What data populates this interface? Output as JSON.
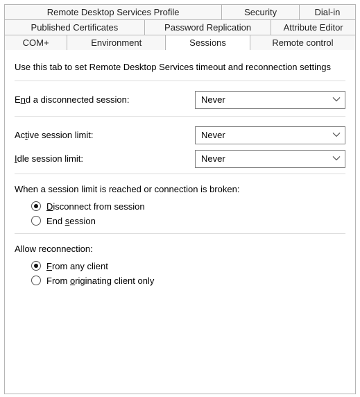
{
  "tabs": {
    "row1": [
      "Remote Desktop Services Profile",
      "Security",
      "Dial-in"
    ],
    "row2": [
      "Published Certificates",
      "Password Replication",
      "Attribute Editor"
    ],
    "row3": [
      "COM+",
      "Environment",
      "Sessions",
      "Remote control"
    ],
    "active": "Sessions"
  },
  "intro": "Use this tab to set Remote Desktop Services timeout and reconnection settings",
  "fields": {
    "end_disconnected": {
      "label_pre": "E",
      "label_u": "n",
      "label_post": "d a disconnected session:",
      "value": "Never"
    },
    "active_limit": {
      "label_pre": "Ac",
      "label_u": "t",
      "label_post": "ive session limit:",
      "value": "Never"
    },
    "idle_limit": {
      "label_pre": "",
      "label_u": "I",
      "label_post": "dle session limit:",
      "value": "Never"
    }
  },
  "limit_section": {
    "heading": "When a session limit is reached or connection is broken:",
    "opt1_pre": "",
    "opt1_u": "D",
    "opt1_post": "isconnect from session",
    "opt2_pre": "End ",
    "opt2_u": "s",
    "opt2_post": "ession",
    "selected": "disconnect"
  },
  "reconnect_section": {
    "heading": "Allow reconnection:",
    "opt1_pre": "",
    "opt1_u": "F",
    "opt1_post": "rom any client",
    "opt2_pre": "From ",
    "opt2_u": "o",
    "opt2_post": "riginating client only",
    "selected": "any"
  }
}
